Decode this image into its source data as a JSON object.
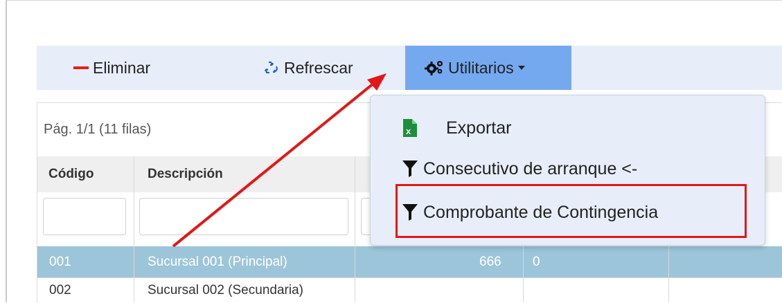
{
  "toolbar": {
    "eliminar_label": "Eliminar",
    "refrescar_label": "Refrescar",
    "utilitarios_label": "Utilitarios"
  },
  "grid": {
    "page_info": "Pág. 1/1 (11 filas)",
    "columns": [
      "Código",
      "Descripción"
    ],
    "rows": [
      {
        "codigo": "001",
        "descripcion": "Sucursal 001 (Principal)",
        "valor": "666",
        "extra": "0"
      },
      {
        "codigo": "002",
        "descripcion": "Sucursal 002 (Secundaria)",
        "valor": "",
        "extra": ""
      }
    ]
  },
  "dropdown": {
    "items": [
      {
        "label": "Exportar",
        "icon": "excel-icon"
      },
      {
        "label": "Consecutivo de arranque <-",
        "icon": "funnel-icon"
      },
      {
        "label": "Comprobante de Contingencia",
        "icon": "funnel-icon"
      }
    ]
  },
  "colors": {
    "toolbar_bg": "#e7eef9",
    "active_button": "#74a9f0",
    "selected_row": "#9dc5d9",
    "annotation_red": "#e01818"
  }
}
